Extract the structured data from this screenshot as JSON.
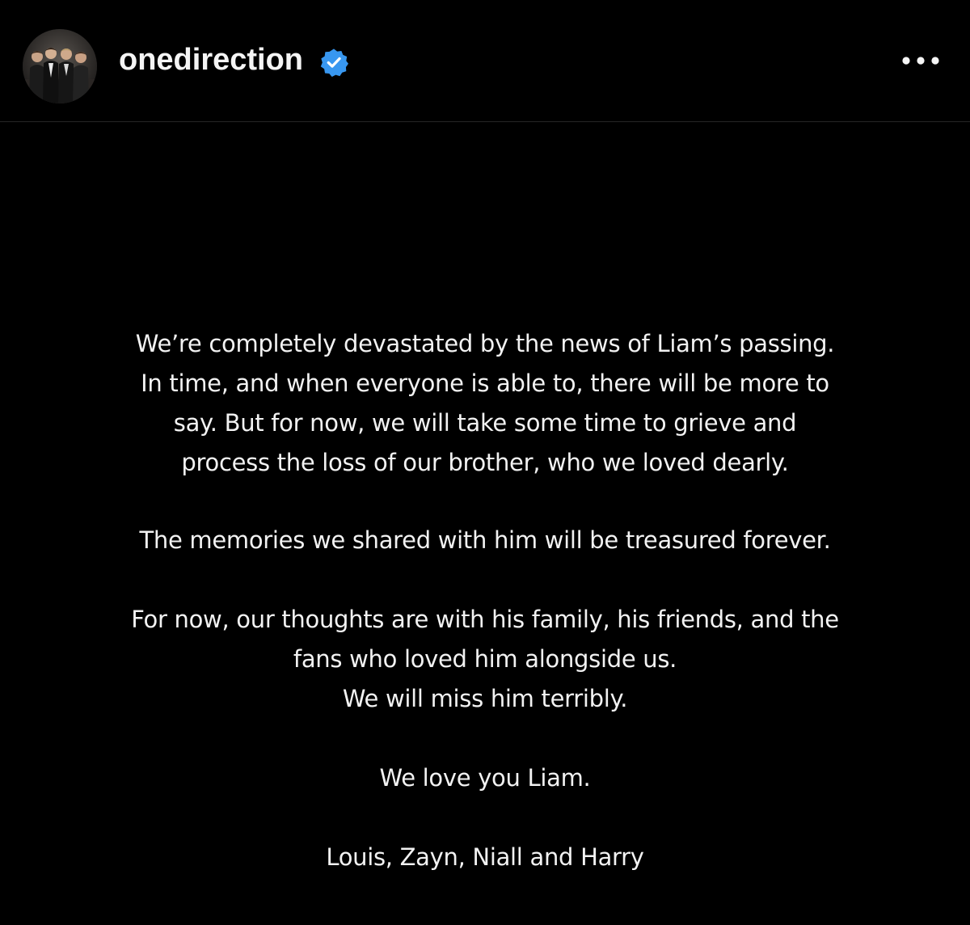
{
  "header": {
    "username": "onedirection",
    "verified_icon": "verified-badge-icon",
    "more_icon": "more-horizontal-icon",
    "verified_color": "#3897f0"
  },
  "post": {
    "background_color": "#000000",
    "text_color": "#f2f2f2",
    "paragraphs": [
      "We’re completely devastated by the news of Liam’s passing.\nIn time, and when everyone is able to, there will be more to\nsay. But for now, we will take some time to grieve and\nprocess the loss of our brother, who we loved dearly.",
      "The memories we shared with him will be treasured forever.",
      "For now, our thoughts are with his family, his friends, and the\nfans who loved him alongside us.\nWe will miss him terribly.",
      "We love you Liam.",
      "Louis, Zayn, Niall and Harry"
    ]
  }
}
